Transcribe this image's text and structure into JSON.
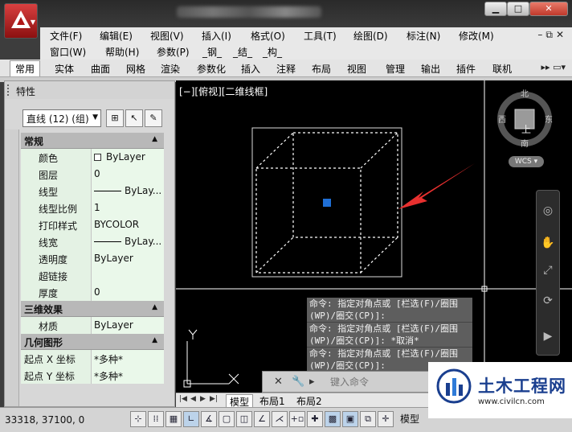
{
  "menu": {
    "row1": [
      "文件(F)",
      "编辑(E)",
      "视图(V)",
      "插入(I)",
      "格式(O)",
      "工具(T)",
      "绘图(D)",
      "标注(N)",
      "修改(M)"
    ],
    "row2": [
      "窗口(W)",
      "帮助(H)",
      "参数(P)",
      "_钢_",
      "_结_",
      "_构_"
    ]
  },
  "ribbon_tabs": [
    "常用",
    "实体",
    "曲面",
    "网格",
    "渲染",
    "参数化",
    "插入",
    "注释",
    "布局",
    "视图",
    "管理",
    "输出",
    "插件",
    "联机"
  ],
  "properties": {
    "title": "特性",
    "selection": "直线 (12) (组)",
    "sections": [
      {
        "name": "常规",
        "rows": [
          {
            "key": "颜色",
            "value": "ByLayer",
            "swatch": true
          },
          {
            "key": "图层",
            "value": "0"
          },
          {
            "key": "线型",
            "value": "ByLay...",
            "line": true
          },
          {
            "key": "线型比例",
            "value": "1"
          },
          {
            "key": "打印样式",
            "value": "BYCOLOR"
          },
          {
            "key": "线宽",
            "value": "ByLay...",
            "line": true
          },
          {
            "key": "透明度",
            "value": "ByLayer"
          },
          {
            "key": "超链接",
            "value": ""
          },
          {
            "key": "厚度",
            "value": "0"
          }
        ]
      },
      {
        "name": "三维效果",
        "rows": [
          {
            "key": "材质",
            "value": "ByLayer"
          }
        ]
      },
      {
        "name": "几何图形",
        "rows": [
          {
            "key": "起点 X 坐标",
            "value": "*多种*"
          },
          {
            "key": "起点 Y 坐标",
            "value": "*多种*"
          }
        ]
      }
    ]
  },
  "viewport": {
    "label": "[−][俯视][二维线框]",
    "compass": {
      "n": "北",
      "s": "南",
      "w": "西",
      "e": "东",
      "center": "上"
    },
    "wcs": "WCS",
    "ucs_x": "X",
    "ucs_y": "Y"
  },
  "command": {
    "history": [
      "命令: 指定对角点或 [栏选(F)/圈围(WP)/圈交(CP)]:",
      "命令: 指定对角点或 [栏选(F)/圈围(WP)/圈交(CP)]: *取消*",
      "命令: 指定对角点或 [栏选(F)/圈围(WP)/圈交(CP)]:"
    ],
    "placeholder": "键入命令"
  },
  "layout_tabs": [
    "模型",
    "布局1",
    "布局2"
  ],
  "status": {
    "coords": "33318, 37100, 0",
    "model": "模型"
  },
  "watermark": {
    "name": "土木工程网",
    "url": "www.civilcn.com"
  },
  "colors": {
    "grip": "#1f6fd6",
    "arrow": "#e8302f",
    "wm_blue": "#1a3f8f"
  }
}
